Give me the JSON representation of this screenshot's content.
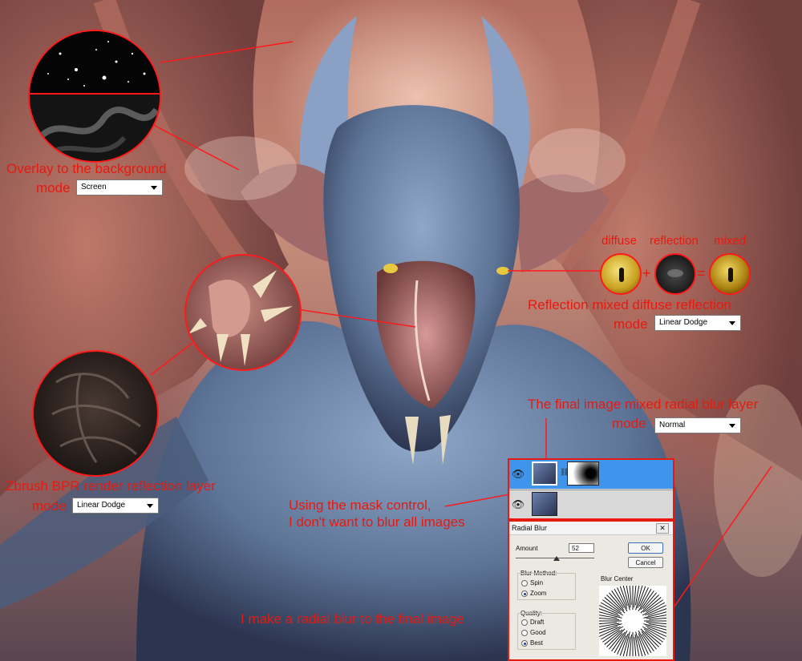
{
  "annotations": {
    "overlay_line1": "Overlay to the background",
    "mode_label": "mode",
    "overlay_mode_value": "Screen",
    "eye_labels": {
      "diffuse": "diffuse",
      "reflection": "reflection",
      "mixed": "mixed"
    },
    "eye_symbols": {
      "plus": "+",
      "equals": "="
    },
    "reflection_line1": "Reflection mixed diffuse reflection",
    "reflection_mode_value": "Linear Dodge",
    "final_line1": "The final image mixed  radial blur layer",
    "final_mode_value": "Normal",
    "zbrush_line1": "Zbrush BPR render reflection layer",
    "zbrush_mode_value": "Linear Dodge",
    "mask_line1": "Using the mask control,",
    "mask_line2": "I don't want to blur all images",
    "radial_note": "I make a radial blur to the final image"
  },
  "dialog": {
    "title": "Radial Blur",
    "close_symbol": "✕",
    "amount_label": "Amount",
    "amount_value": "52",
    "amount_fraction": 0.52,
    "ok_label": "OK",
    "cancel_label": "Cancel",
    "method_label": "Blur Method:",
    "methods": [
      "Spin",
      "Zoom"
    ],
    "selected_method": "Zoom",
    "quality_label": "Quality:",
    "qualities": [
      "Draft",
      "Good",
      "Best"
    ],
    "selected_quality": "Best",
    "center_label": "Blur Center"
  },
  "colors": {
    "annotation": "#e8190f",
    "circle_border": "#ff1a1a",
    "layer_selected": "#3f95ec"
  }
}
